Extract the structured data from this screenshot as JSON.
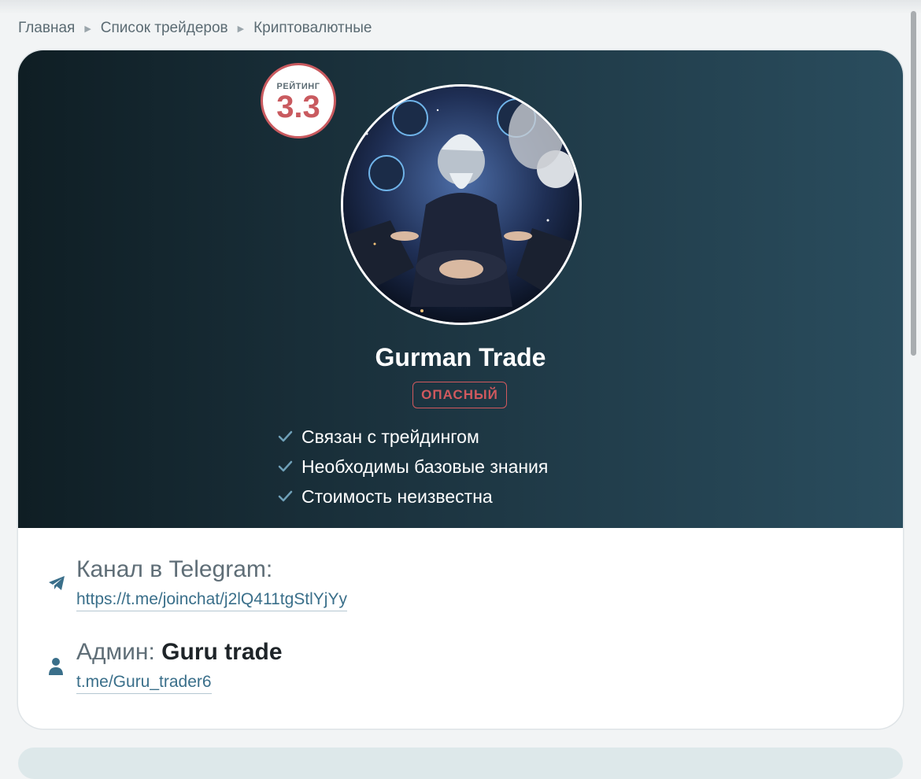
{
  "breadcrumb": {
    "items": [
      "Главная",
      "Список трейдеров",
      "Криптовалютные"
    ]
  },
  "trader": {
    "rating_label": "РЕЙТИНГ",
    "rating_value": "3.3",
    "name": "Gurman Trade",
    "status": "ОПАСНЫЙ",
    "features": [
      "Связан с трейдингом",
      "Необходимы базовые знания",
      "Стоимость неизвестна"
    ]
  },
  "info": {
    "telegram_title": "Канал в Telegram:",
    "telegram_link": "https://t.me/joinchat/j2lQ411tgStlYjYy",
    "admin_title": "Админ:",
    "admin_name": "Guru trade",
    "admin_link": "t.me/Guru_trader6"
  },
  "colors": {
    "danger": "#d0595e",
    "link": "#3a6f8a",
    "hero_dark": "#0f1e24",
    "hero_light": "#2a4d5e"
  },
  "icons": [
    "chevron-right-icon",
    "check-icon",
    "telegram-plane-icon",
    "user-icon"
  ]
}
